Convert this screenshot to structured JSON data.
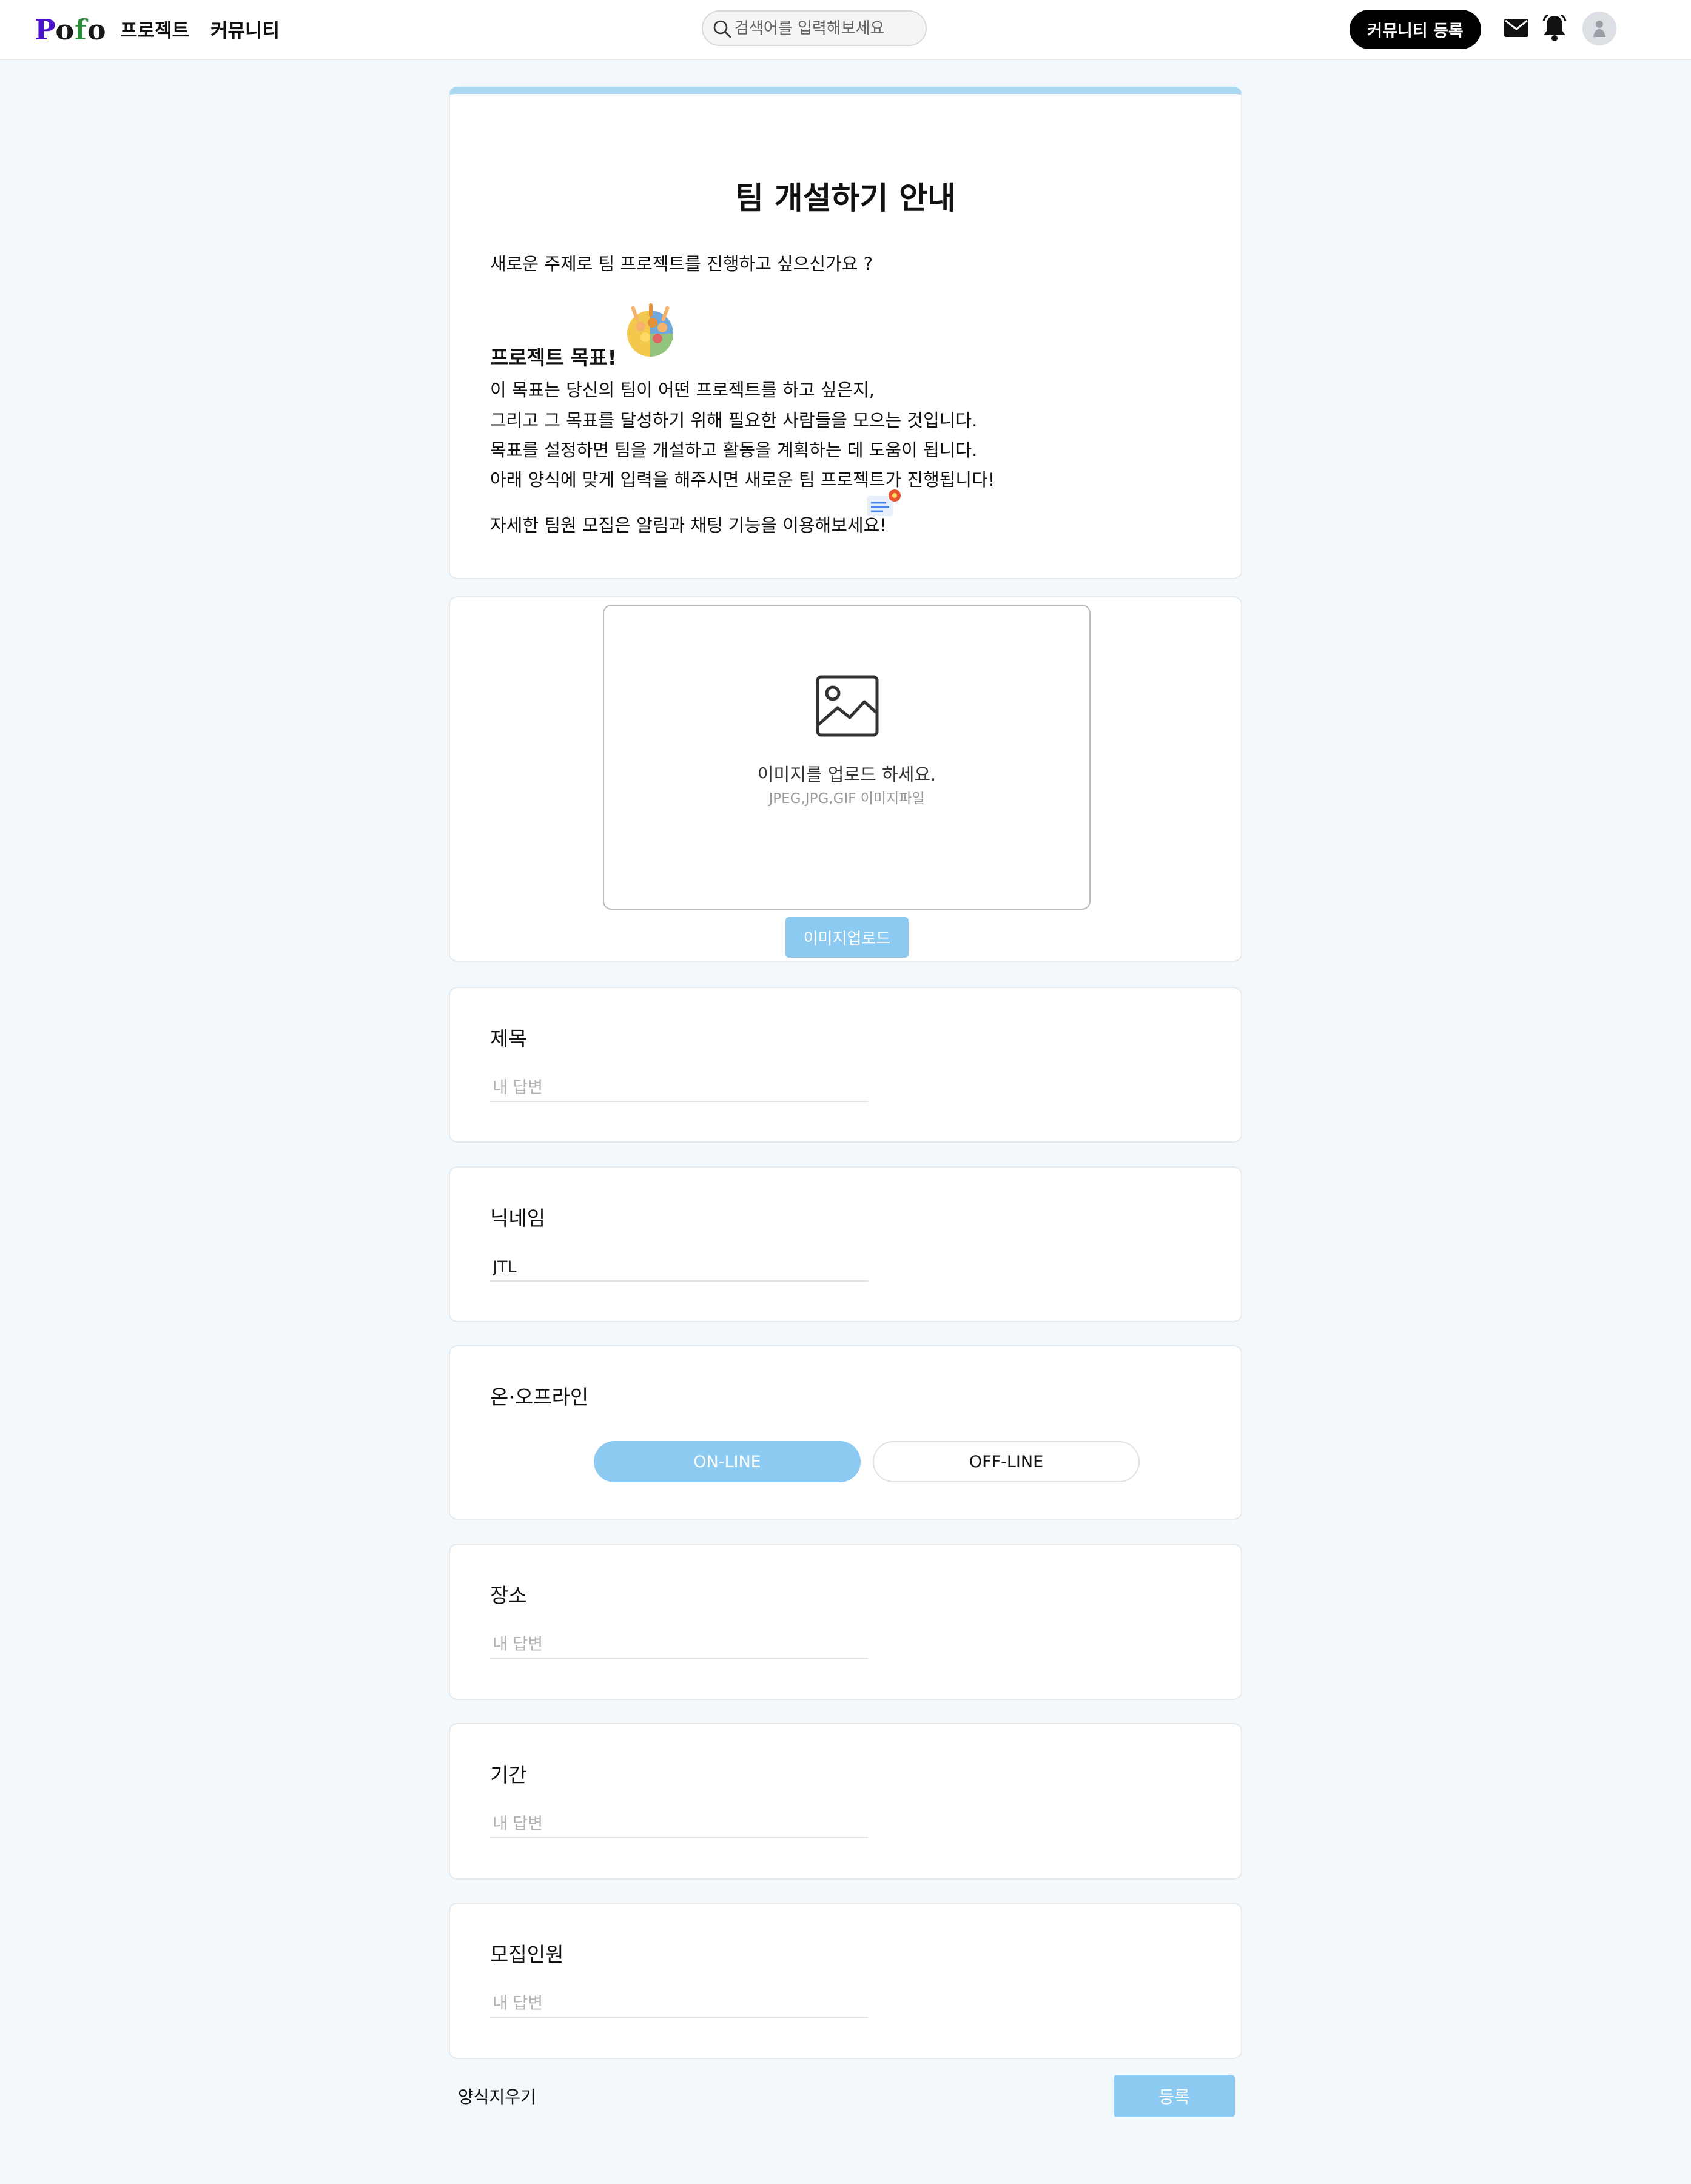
{
  "header": {
    "logo_letters": [
      "P",
      "o",
      "f",
      "o"
    ],
    "nav": {
      "project": "프로젝트",
      "community": "커뮤니티"
    },
    "search": {
      "placeholder": "검색어를 입력해보세요"
    },
    "register_button": "커뮤니티 등록",
    "icons": [
      "mail-icon",
      "bell-icon",
      "avatar"
    ]
  },
  "intro": {
    "title": "팀 개설하기 안내",
    "question": "새로운 주제로 팀 프로젝트를 진행하고 싶으신가요 ?",
    "goal_heading": "프로젝트 목표!",
    "lines": [
      "이 목표는 당신의 팀이 어떤 프로젝트를 하고 싶은지,",
      "그리고 그 목표를 달성하기 위해 필요한 사람들을 모으는 것입니다.",
      "목표를 설정하면 팀을 개설하고 활동을 계획하는 데 도움이 됩니다.",
      "아래 양식에 맞게 입력을 해주시면 새로운 팀 프로젝트가 진행됩니다!",
      "자세한 팀원 모집은 알림과 채팅 기능을 이용해보세요!"
    ]
  },
  "upload": {
    "text": "이미지를 업로드 하세요.",
    "subtext": "JPEG,JPG,GIF 이미지파일",
    "button": "이미지업로드"
  },
  "form": {
    "title": {
      "label": "제목",
      "placeholder": "내 답변",
      "value": ""
    },
    "nickname": {
      "label": "닉네임",
      "placeholder": "내 답변",
      "value": "JTL"
    },
    "mode": {
      "label": "온·오프라인",
      "online": "ON-LINE",
      "offline": "OFF-LINE",
      "selected": "ON-LINE"
    },
    "place": {
      "label": "장소",
      "placeholder": "내 답변",
      "value": ""
    },
    "period": {
      "label": "기간",
      "placeholder": "내 답변",
      "value": ""
    },
    "recruit": {
      "label": "모집인원",
      "placeholder": "내 답변",
      "value": ""
    }
  },
  "footer": {
    "reset": "양식지우기",
    "submit": "등록"
  },
  "colors": {
    "accent": "#8ccaf1",
    "accent_bar": "#a9d7f2",
    "page_background": "#f2f8fb",
    "header_button": "#000000"
  }
}
